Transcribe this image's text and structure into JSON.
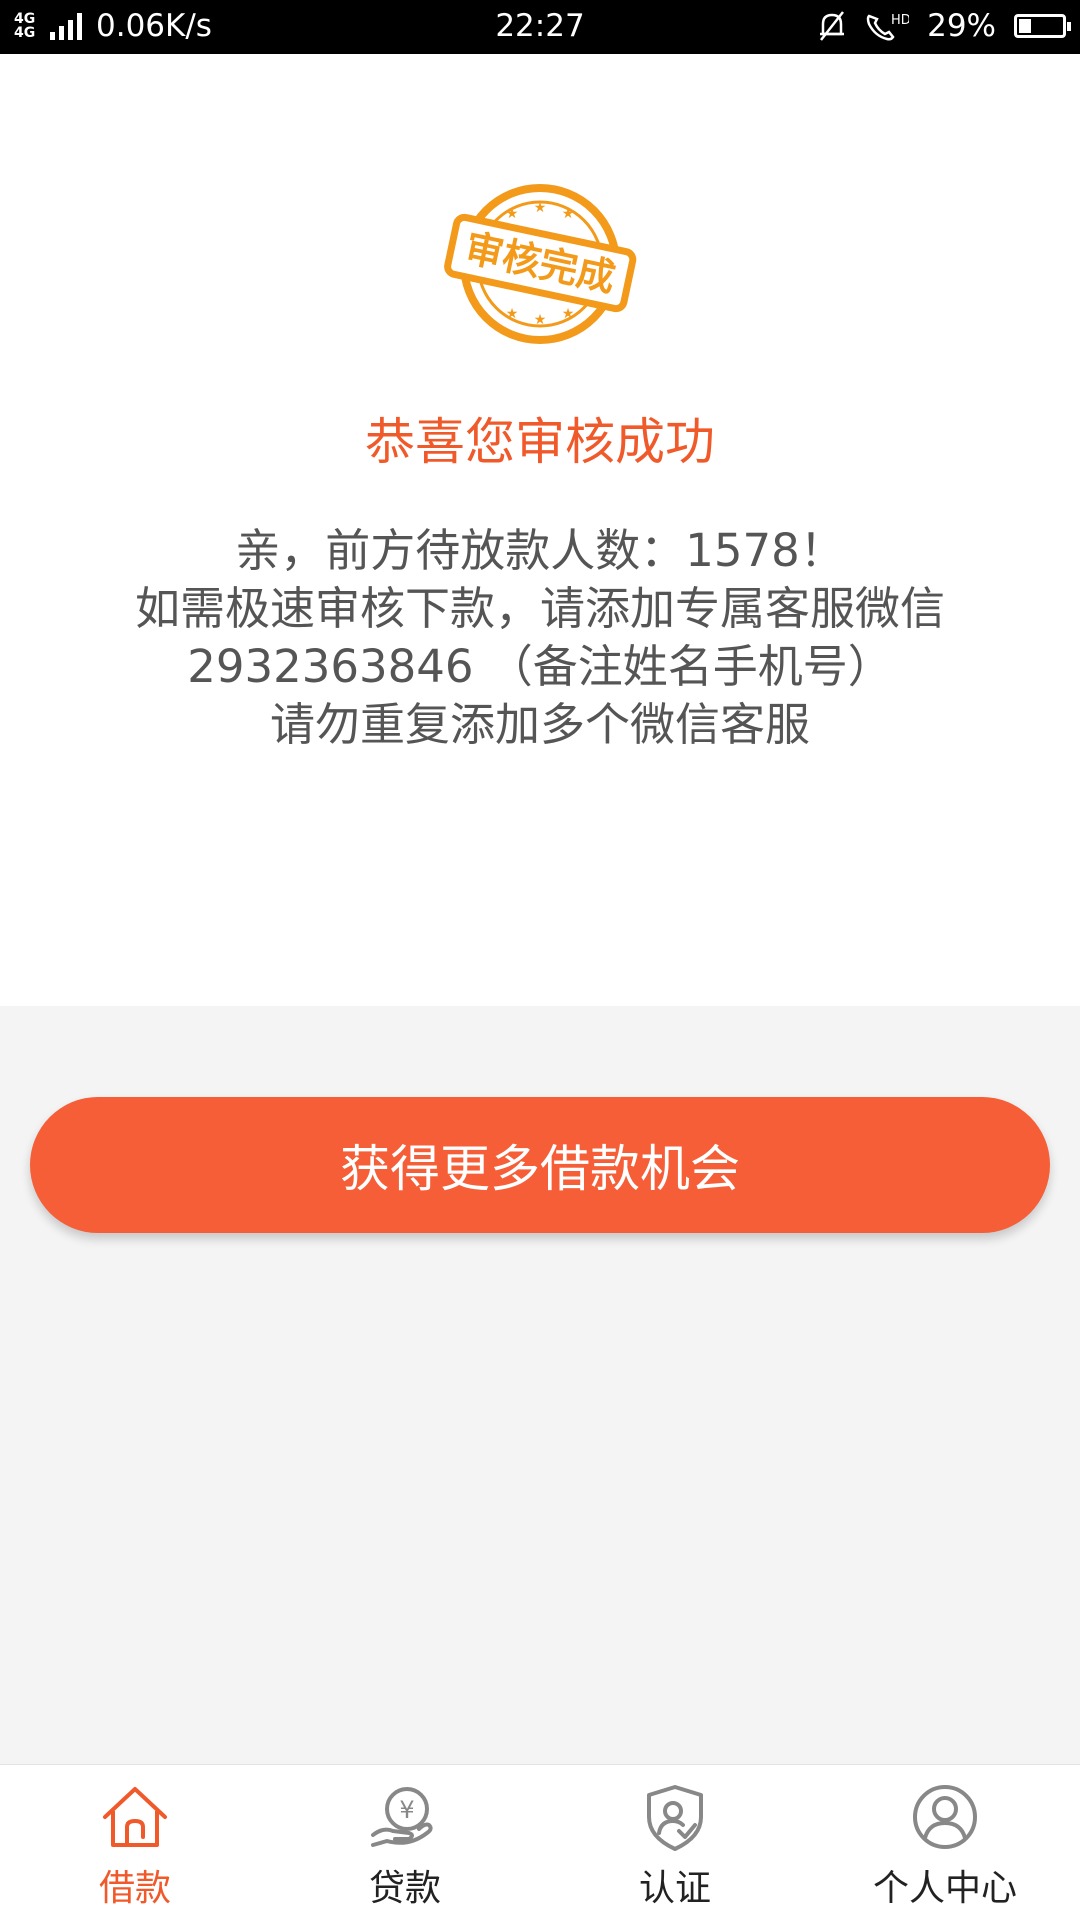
{
  "status_bar": {
    "network": "4G 4G",
    "speed": "0.06K/s",
    "time": "22:27",
    "battery": "29%",
    "battery_level": 0.29
  },
  "stamp": {
    "text": "审核完成",
    "color": "#f39a1b"
  },
  "title": "恭喜您审核成功",
  "message_lines": [
    "亲，前方待放款人数：1578！",
    "如需极速审核下款，请添加专属客服微信",
    "2932363846 （备注姓名手机号）",
    "请勿重复添加多个微信客服"
  ],
  "cta_button": "获得更多借款机会",
  "tabs": [
    {
      "label": "借款",
      "icon": "home-icon",
      "active": true
    },
    {
      "label": "贷款",
      "icon": "yuan-hand-icon",
      "active": false
    },
    {
      "label": "认证",
      "icon": "shield-user-icon",
      "active": false
    },
    {
      "label": "个人中心",
      "icon": "user-circle-icon",
      "active": false
    }
  ],
  "colors": {
    "accent": "#f05a2a",
    "button": "#f55e36",
    "icon_gray": "#888888"
  }
}
